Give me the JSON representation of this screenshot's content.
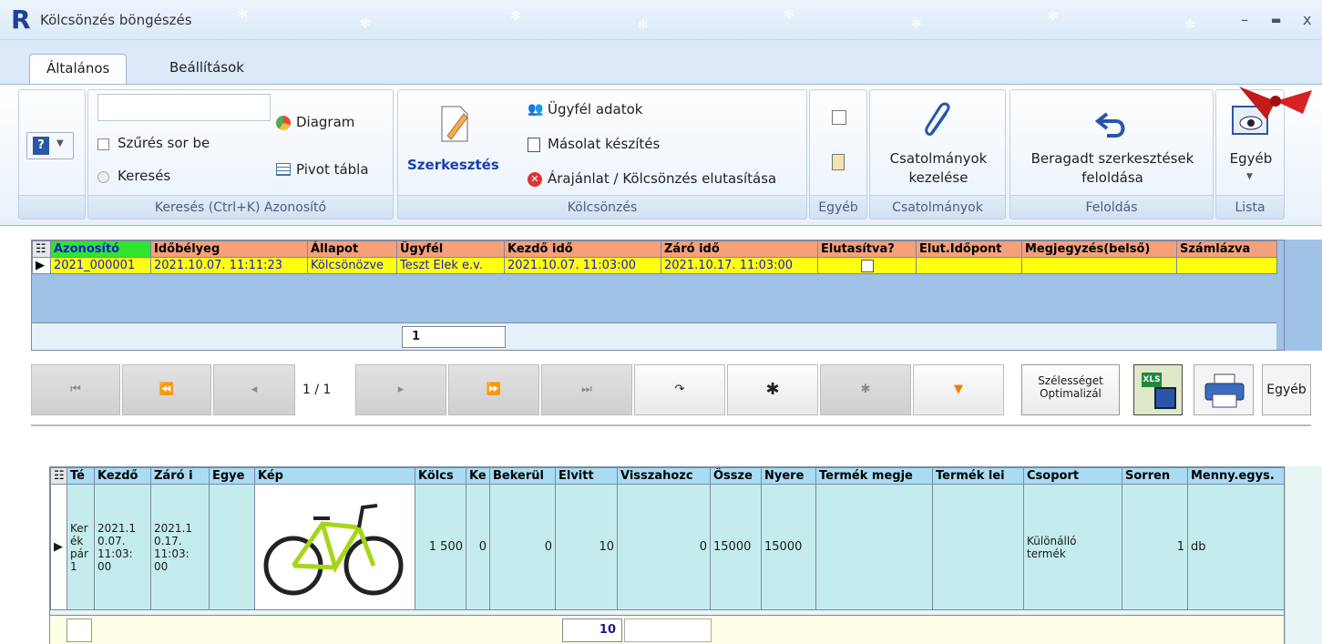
{
  "window": {
    "title": "Kölcsönzés böngészés",
    "app_letter": "R"
  },
  "tabs": [
    {
      "label": "Általános",
      "active": true
    },
    {
      "label": "Beállítások",
      "active": false
    }
  ],
  "ribbon": {
    "search": {
      "input_value": "",
      "filter_row": "Szűrés sor be",
      "search_radio": "Keresés",
      "diagram": "Diagram",
      "pivot": "Pivot tábla",
      "group_label": "Keresés (Ctrl+K) Azonosító"
    },
    "rental": {
      "edit": "Szerkesztés",
      "customer": "Ügyfél adatok",
      "copy": "Másolat készítés",
      "reject": "Árajánlat / Kölcsönzés elutasítása",
      "group_label": "Kölcsönzés"
    },
    "other": {
      "group_label": "Egyéb"
    },
    "attachments": {
      "line1": "Csatolmányok",
      "line2": "kezelése",
      "group_label": "Csatolmányok"
    },
    "unlock": {
      "line1": "Beragadt szerkesztések",
      "line2": "feloldása",
      "group_label": "Feloldás"
    },
    "list": {
      "label": "Egyéb",
      "group_label": "Lista"
    }
  },
  "grid1": {
    "columns": [
      "Azonosító",
      "Időbélyeg",
      "Állapot",
      "Ügyfél",
      "Kezdő idő",
      "Záró idő",
      "Elutasítva?",
      "Elut.Időpont",
      "Megjegyzés(belső)",
      "Számlázva"
    ],
    "row": {
      "id": "2021_000001",
      "timestamp": "2021.10.07. 11:11:23",
      "status": "Kölcsönözve",
      "customer": "Teszt Elek e.v.",
      "start": "2021.10.07. 11:03:00",
      "end": "2021.10.17. 11:03:00",
      "rejected": false
    },
    "footer_count": "1"
  },
  "navigator": {
    "page": "1 / 1",
    "optimize_line1": "Szélességet",
    "optimize_line2": "Optimalizál",
    "other": "Egyéb",
    "xls": "XLS"
  },
  "grid2": {
    "columns": [
      "Té",
      "Kezdő",
      "Záró i",
      "Egye",
      "Kép",
      "Kölcs",
      "Ke",
      "Bekerül",
      "Elvitt",
      "Visszahozc",
      "Össze",
      "Nyere",
      "Termék megje",
      "Termék lei",
      "Csoport",
      "Sorren",
      "Menny.egys."
    ],
    "row": {
      "type": "Ker ék pár 1",
      "start": "2021.1 0.07. 11:03: 00",
      "end": "2021.1 0.17. 11:03: 00",
      "rent": "1 500",
      "ke": "0",
      "cost": "0",
      "taken": "10",
      "returned": "0",
      "total": "15000",
      "profit": "15000",
      "group": "Különálló termék",
      "order": "1",
      "unit": "db"
    },
    "footer_sum": "10"
  },
  "colors": {
    "accent_orange": "#f5a07a",
    "key_green": "#2ee52e",
    "selected_yellow": "#ffff10",
    "detail_cyan": "#c5ecec",
    "ribbon_blue": "#dbe9f9"
  }
}
